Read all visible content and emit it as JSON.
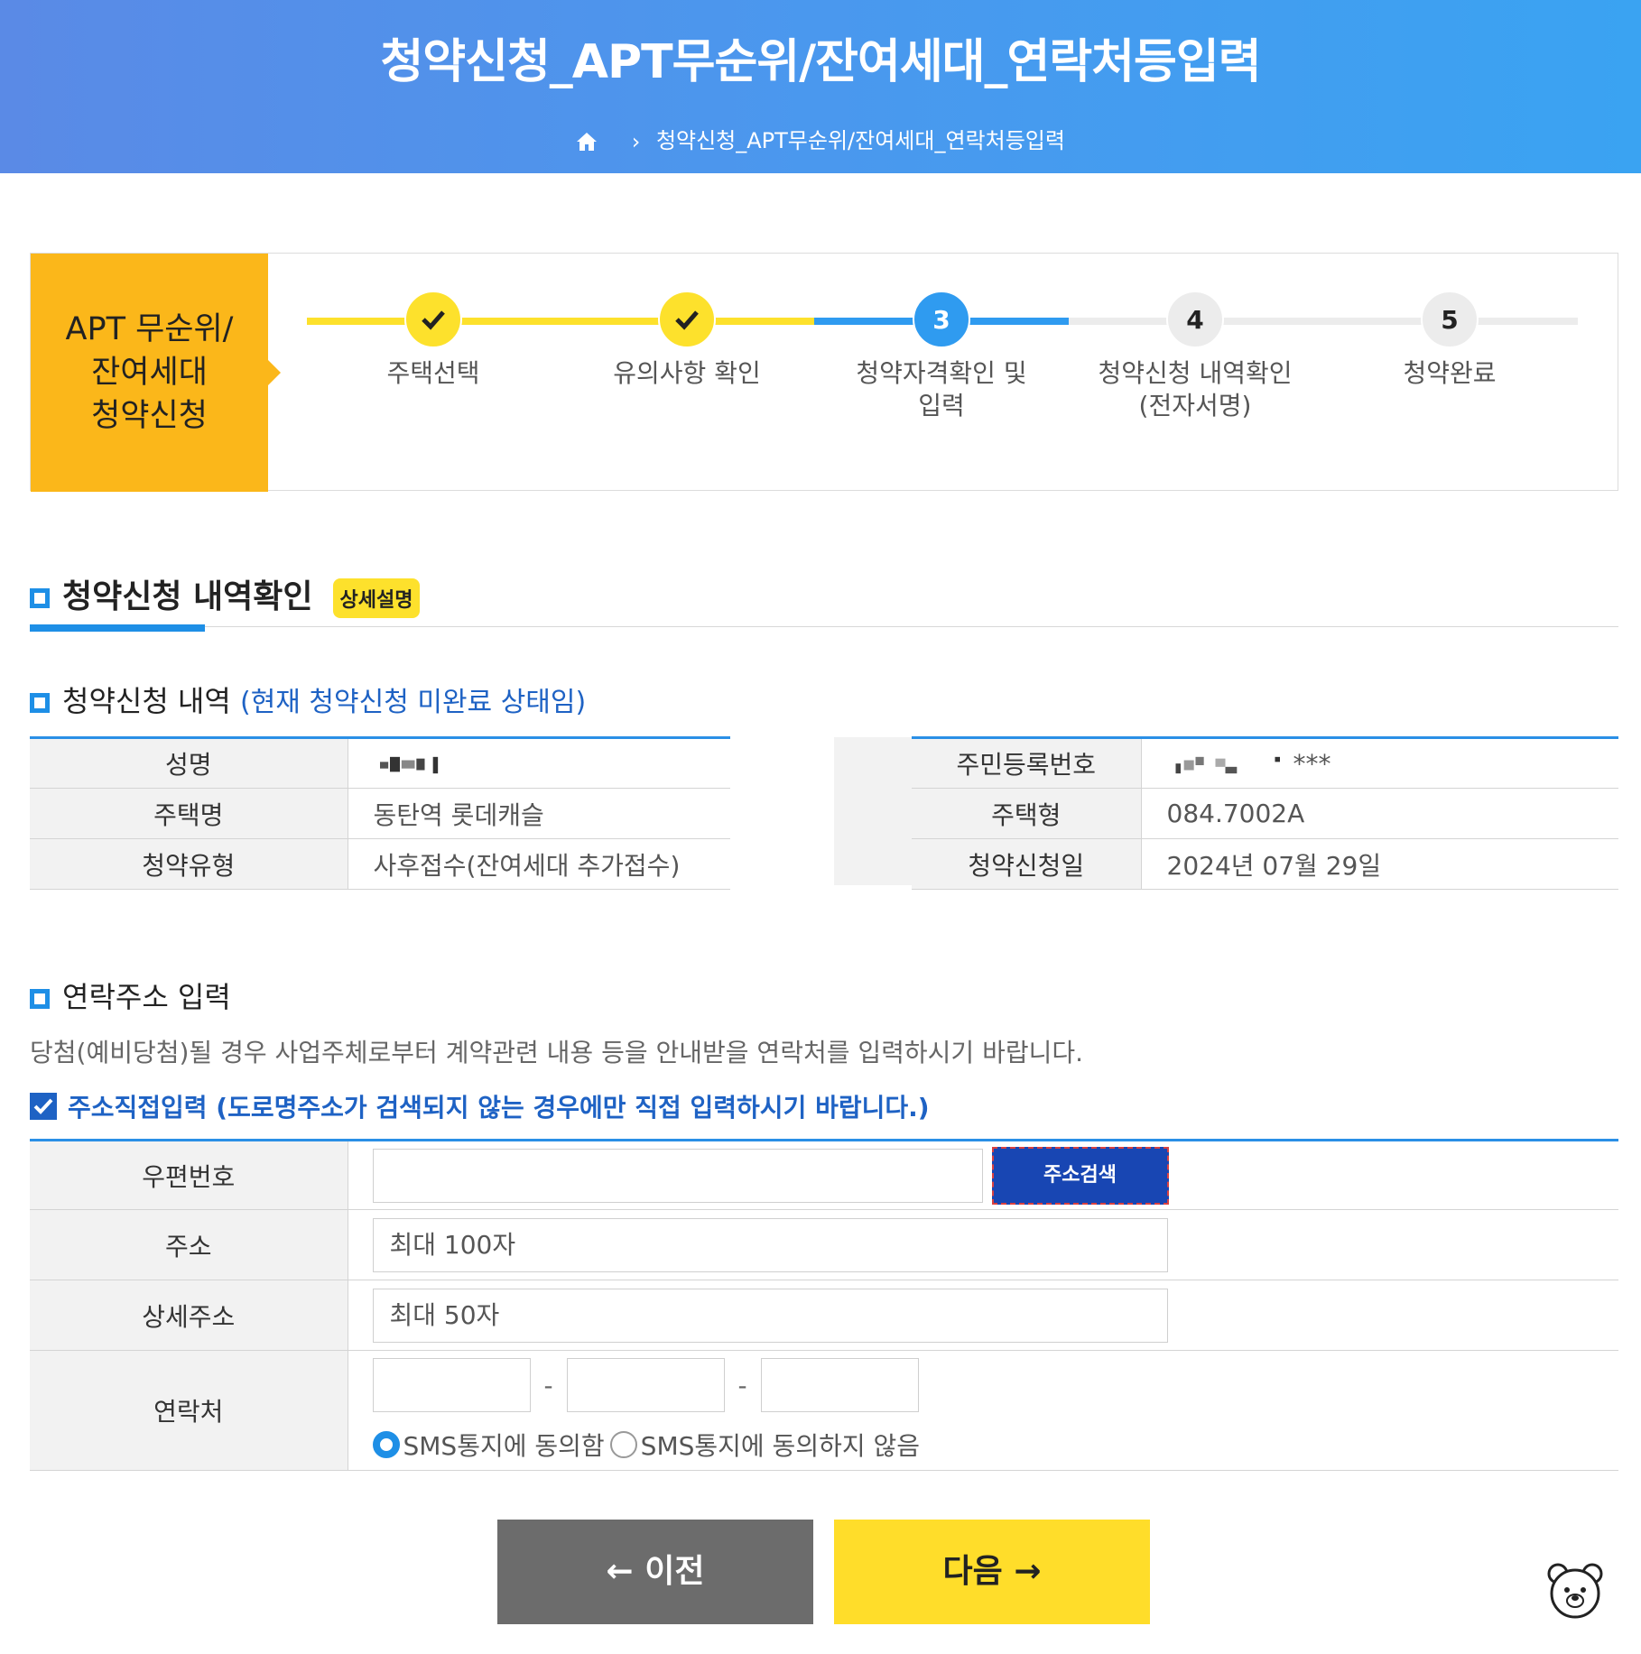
{
  "header": {
    "title": "청약신청_APT무순위/잔여세대_연락처등입력",
    "breadcrumb": "청약신청_APT무순위/잔여세대_연락처등입력"
  },
  "steps": {
    "label_line1": "APT 무순위/",
    "label_line2": "잔여세대",
    "label_line3": "청약신청",
    "items": [
      {
        "number": "",
        "status": "done",
        "label1": "주택선택",
        "label2": ""
      },
      {
        "number": "",
        "status": "done",
        "label1": "유의사항 확인",
        "label2": ""
      },
      {
        "number": "3",
        "status": "active",
        "label1": "청약자격확인 및",
        "label2": "입력"
      },
      {
        "number": "4",
        "status": "todo",
        "label1": "청약신청 내역확인",
        "label2": "(전자서명)"
      },
      {
        "number": "5",
        "status": "todo",
        "label1": "청약완료",
        "label2": ""
      }
    ]
  },
  "section": {
    "title": "청약신청 내역확인",
    "badge": "상세설명"
  },
  "history": {
    "title": "청약신청 내역",
    "note": "(현재 청약신청 미완료 상태임)",
    "left": [
      {
        "label": "성명",
        "value": ""
      },
      {
        "label": "주택명",
        "value": "동탄역 롯데캐슬"
      },
      {
        "label": "청약유형",
        "value": "사후접수(잔여세대 추가접수)"
      }
    ],
    "right": [
      {
        "label": "주민등록번호",
        "value": "***"
      },
      {
        "label": "주택형",
        "value": "084.7002A"
      },
      {
        "label": "청약신청일",
        "value": "2024년 07월 29일"
      }
    ]
  },
  "contact": {
    "title": "연락주소 입력",
    "description": "당첨(예비당첨)될 경우 사업주체로부터 계약관련 내용 등을 안내받을 연락처를 입력하시기 바랍니다.",
    "direct_input_label": "주소직접입력 (도로명주소가 검색되지 않는 경우에만 직접 입력하시기 바랍니다.)",
    "direct_input_checked": true,
    "zip_label": "우편번호",
    "zip_value": "",
    "search_button": "주소검색",
    "address_label": "주소",
    "address_placeholder": "최대 100자",
    "detail_label": "상세주소",
    "detail_placeholder": "최대 50자",
    "phone_label": "연락처",
    "phone_sep": "-",
    "sms_agree": "SMS통지에 동의함",
    "sms_disagree": "SMS통지에 동의하지 않음",
    "sms_selected": "agree"
  },
  "nav": {
    "prev": "이전",
    "next": "다음"
  },
  "colors": {
    "header_start": "#5a8ae6",
    "header_end": "#3aa3f2",
    "accent_blue": "#1e8fe6",
    "step_yellow": "#fde12c",
    "label_orange": "#fbb71a",
    "search_button": "#1846b3",
    "next_button": "#ffdd2a",
    "prev_button": "#6c6c6c"
  }
}
